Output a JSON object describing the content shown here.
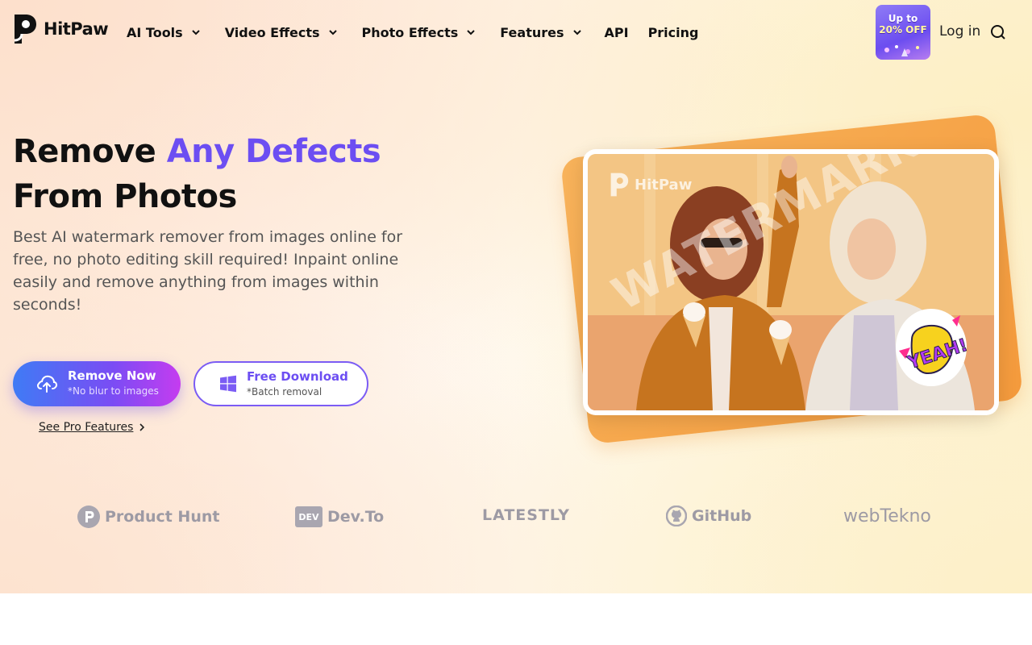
{
  "brand": {
    "name": "HitPaw",
    "accent_color": "#6c4ef2"
  },
  "nav": {
    "items": [
      {
        "label": "AI Tools",
        "has_dropdown": true
      },
      {
        "label": "Video Effects",
        "has_dropdown": true
      },
      {
        "label": "Photo Effects",
        "has_dropdown": true
      },
      {
        "label": "Features",
        "has_dropdown": true
      },
      {
        "label": "API",
        "has_dropdown": false
      },
      {
        "label": "Pricing",
        "has_dropdown": false
      }
    ],
    "promo": {
      "line1": "Up to",
      "line2": "20% OFF"
    },
    "login_label": "Log in",
    "search_icon": "search-icon"
  },
  "hero": {
    "headline_part1": "Remove ",
    "headline_accent": "Any Defects",
    "headline_part2": " From Photos",
    "subtext": "Best AI watermark remover from images online for free, no photo editing skill required! Inpaint online easily and remove anything from images within seconds!",
    "primary_button": {
      "label": "Remove Now",
      "sublabel": "*No blur to images",
      "icon": "upload-cloud-icon"
    },
    "secondary_button": {
      "label": "Free Download",
      "sublabel": "*Batch removal",
      "icon": "windows-icon"
    },
    "pro_link": "See Pro Features",
    "image": {
      "watermark_logo_text": "HitPaw",
      "watermark_text": "WATERMARK",
      "sticker_text": "YEAH!"
    }
  },
  "partners": [
    {
      "name": "Product Hunt",
      "icon": "product-hunt-icon"
    },
    {
      "name": "Dev.To",
      "icon": "dev-icon",
      "badge": "DEV"
    },
    {
      "name": "LATESTLY",
      "icon": "latestly-icon"
    },
    {
      "name": "GitHub",
      "icon": "github-icon"
    },
    {
      "name": "webTekno",
      "icon": "webtekno-icon"
    }
  ]
}
